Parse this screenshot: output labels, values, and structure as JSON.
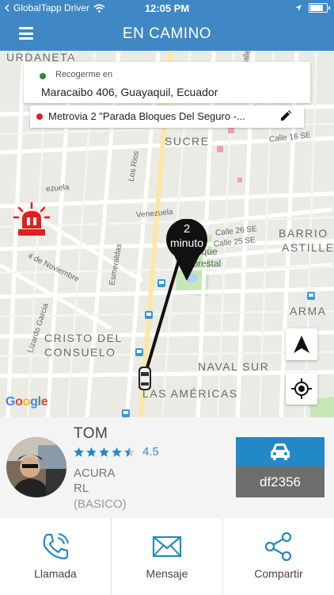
{
  "status_bar": {
    "back_app": "GlobalTapp Driver",
    "time": "12:05 PM"
  },
  "header": {
    "title": "EN CAMINO"
  },
  "map": {
    "labels": {
      "urdaneta": "URDANETA",
      "sucre": "SUCRE",
      "calle16se": "Calle 16 SE",
      "los_rios": "Los Rios",
      "venezuela": "Venezuela",
      "venezuela2": "ezuela",
      "calle26se": "Calle 26 SE",
      "calle25se": "Calle 25 SE",
      "barrio": "BARRIO",
      "astille": "ASTILLE",
      "parque": "Parque",
      "forestal": "Forestal",
      "esmeraldas": "Esmeraldas",
      "noviembre": "4 de Noviembre",
      "lizardo": "Lizardo Garcia",
      "armas": "ARMA",
      "cristo1": "CRISTO DEL",
      "cristo2": "CONSUELO",
      "naval": "NAVAL SUR",
      "americas": "LAS AMÉRICAS",
      "calle_a": "Calle"
    },
    "pickup": {
      "label": "Recogerme en",
      "address": "Maracaibo 406, Guayaquil, Ecuador"
    },
    "destination": {
      "address": "Metrovia 2 \"Parada Bloques Del Seguro -..."
    },
    "eta": {
      "value": "2",
      "unit": "minuto"
    },
    "attribution": "Google"
  },
  "driver": {
    "name": "TOM",
    "rating": "4.5",
    "rating_value": 4.5,
    "car_make": "ACURA",
    "car_model": "RL",
    "category": "(BASICO)",
    "plate": "df2356"
  },
  "actions": [
    {
      "label": "Llamada"
    },
    {
      "label": "Mensaje"
    },
    {
      "label": "Compartir"
    }
  ],
  "colors": {
    "brand": "#3f88c5",
    "vehicle_box": "#2389c6",
    "plate_bg": "#6d6d6d",
    "pickup_dot": "#2f8a2f",
    "destination_dot": "#e02020",
    "siren": "#e02020"
  }
}
